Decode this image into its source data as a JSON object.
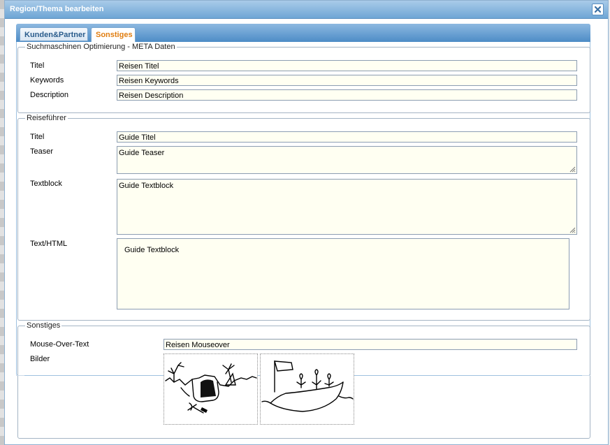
{
  "dialog": {
    "title": "Region/Thema bearbeiten",
    "close_icon": "close-icon"
  },
  "tabs": [
    {
      "label": "Kunden&Partner",
      "active": false
    },
    {
      "label": "Sonstiges",
      "active": true
    }
  ],
  "seo": {
    "legend": "Suchmaschinen Optimierung - META Daten",
    "titel_label": "Titel",
    "titel_value": "Reisen Titel",
    "keywords_label": "Keywords",
    "keywords_value": "Reisen Keywords",
    "description_label": "Description",
    "description_value": "Reisen Description"
  },
  "guide": {
    "legend": "Reiseführer",
    "titel_label": "Titel",
    "titel_value": "Guide Titel",
    "teaser_label": "Teaser",
    "teaser_value": "Guide Teaser",
    "textblock_label": "Textblock",
    "textblock_value": "Guide Textblock",
    "html_label": "Text/HTML",
    "html_value": "Guide Textblock"
  },
  "misc": {
    "legend": "Sonstiges",
    "mouseover_label": "Mouse-Over-Text",
    "mouseover_value": "Reisen Mouseover",
    "bilder_label": "Bilder",
    "images": [
      "island-sketch-image",
      "boat-sketch-image"
    ]
  },
  "colors": {
    "titlebar": "#6ea6d5",
    "active_tab_text": "#e07d10",
    "input_bg": "#fffff2"
  }
}
